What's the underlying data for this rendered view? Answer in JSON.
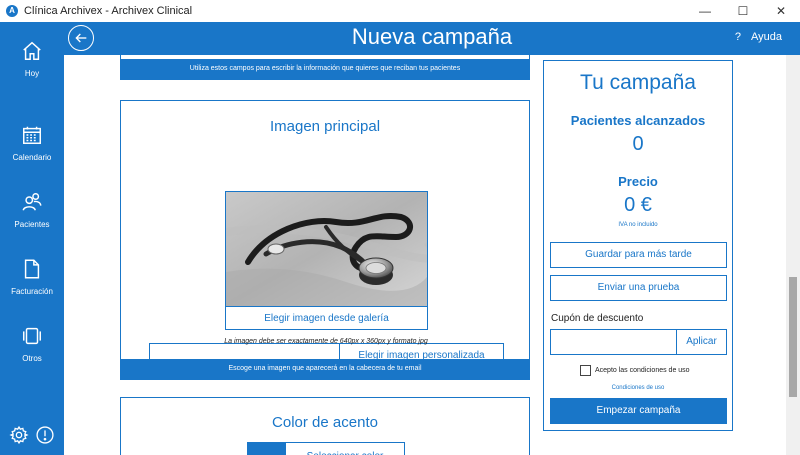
{
  "window": {
    "title": "Clínica Archivex - Archivex Clinical",
    "minimize": "—",
    "maximize": "☐",
    "close": "✕"
  },
  "sidebar": {
    "items": [
      {
        "label": "Hoy",
        "icon": "home-icon"
      },
      {
        "label": "Calendario",
        "icon": "calendar-icon"
      },
      {
        "label": "Pacientes",
        "icon": "patients-icon"
      },
      {
        "label": "Facturación",
        "icon": "invoice-icon"
      },
      {
        "label": "Otros",
        "icon": "others-icon"
      }
    ],
    "bottom": [
      {
        "icon": "settings-icon"
      },
      {
        "icon": "alert-icon"
      }
    ]
  },
  "header": {
    "title": "Nueva campaña",
    "help_icon": "?",
    "help_label": "Ayuda"
  },
  "form": {
    "fields_hint": "Utiliza estos campos para escribir la información que quieres que reciban tus pacientes",
    "image_section": {
      "title": "Imagen principal",
      "gallery_label": "Elegir imagen desde galería",
      "custom_input_value": "",
      "custom_label": "Elegir imagen personalizada",
      "requirement": "La imagen debe ser exactamente de 640px x 360px y formato jpg",
      "footer": "Escoge una imagen que aparecerá en la cabecera de tu email"
    },
    "accent_section": {
      "title": "Color de acento",
      "select_label": "Seleccionar color",
      "swatch": "#1976c8"
    }
  },
  "summary": {
    "title": "Tu campaña",
    "reached_label": "Pacientes alcanzados",
    "reached_value": "0",
    "price_label": "Precio",
    "price_value": "0 €",
    "vat_note": "IVA no incluido",
    "save_later": "Guardar para más tarde",
    "send_test": "Enviar una prueba",
    "coupon_label": "Cupón de descuento",
    "coupon_value": "",
    "apply": "Aplicar",
    "accept_terms": "Acepto las condiciones de uso",
    "terms_link": "Condiciones de uso",
    "start": "Empezar campaña"
  },
  "colors": {
    "accent": "#1976c8"
  }
}
